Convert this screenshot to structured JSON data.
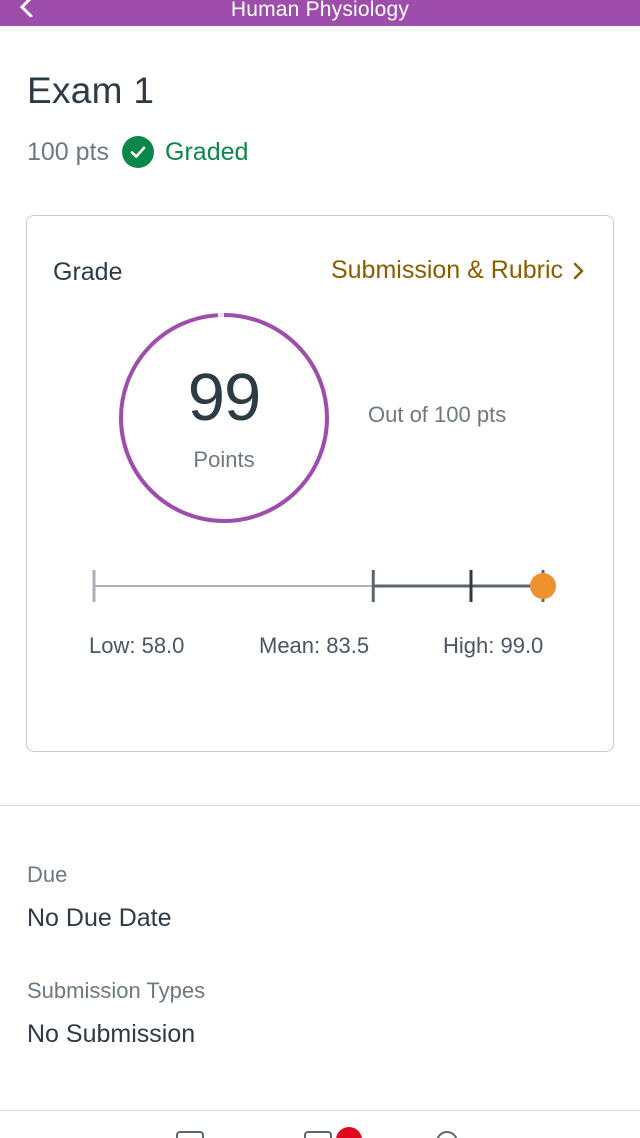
{
  "header": {
    "course_name": "Human Physiology",
    "back_icon": "chevron-left-icon",
    "background_color": "#9e4dac"
  },
  "assignment": {
    "title": "Exam 1",
    "points_possible": "100 pts",
    "status_icon": "check-circle-icon",
    "status": "Graded",
    "status_color": "#0b874b"
  },
  "grade_card": {
    "heading": "Grade",
    "link_label": "Submission & Rubric",
    "link_icon": "chevron-right-icon",
    "link_color": "#8b5c00",
    "score": "99",
    "score_unit": "Points",
    "score_fraction": 0.99,
    "ring_color": "#9e4dac",
    "out_of": "Out of 100 pts",
    "stats": {
      "low_label": "Low: 58.0",
      "mean_label": "Mean: 83.5",
      "high_label": "High: 99.0",
      "low": 58.0,
      "mean": 83.5,
      "high": 99.0,
      "score": 99,
      "marker_color": "#f0912f"
    }
  },
  "details": {
    "due_label": "Due",
    "due_value": "No Due Date",
    "submission_types_label": "Submission Types",
    "submission_types_value": "No Submission"
  },
  "tab_bar": {
    "icons": [
      "calendar-icon",
      "inbox-icon",
      "notifications-icon"
    ],
    "badge_color": "#e0061f"
  }
}
